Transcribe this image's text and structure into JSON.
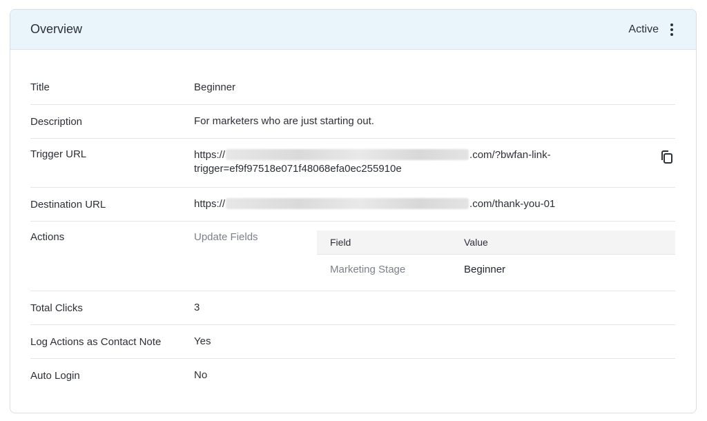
{
  "header": {
    "title": "Overview",
    "status": "Active"
  },
  "rows": {
    "title": {
      "label": "Title",
      "value": "Beginner"
    },
    "description": {
      "label": "Description",
      "value": "For marketers who are just starting out."
    },
    "trigger_url": {
      "label": "Trigger URL",
      "prefix": "https://",
      "suffix_line1": ".com/?bwfan-link-",
      "suffix_line2": "trigger=ef9f97518e071f48068efa0ec255910e"
    },
    "destination_url": {
      "label": "Destination URL",
      "prefix": "https://",
      "suffix": ".com/thank-you-01"
    },
    "actions": {
      "label": "Actions",
      "action_name": "Update Fields",
      "table": {
        "headers": [
          "Field",
          "Value"
        ],
        "rows": [
          {
            "field": "Marketing Stage",
            "value": "Beginner"
          }
        ]
      }
    },
    "total_clicks": {
      "label": "Total Clicks",
      "value": "3"
    },
    "log_actions": {
      "label": "Log Actions as Contact Note",
      "value": "Yes"
    },
    "auto_login": {
      "label": "Auto Login",
      "value": "No"
    }
  },
  "icons": {
    "menu": "kebab-menu-icon",
    "copy": "copy-icon"
  },
  "colors": {
    "header_bg": "#eaf4fb",
    "muted_text": "#7b8089",
    "border": "#e3e6ea"
  }
}
